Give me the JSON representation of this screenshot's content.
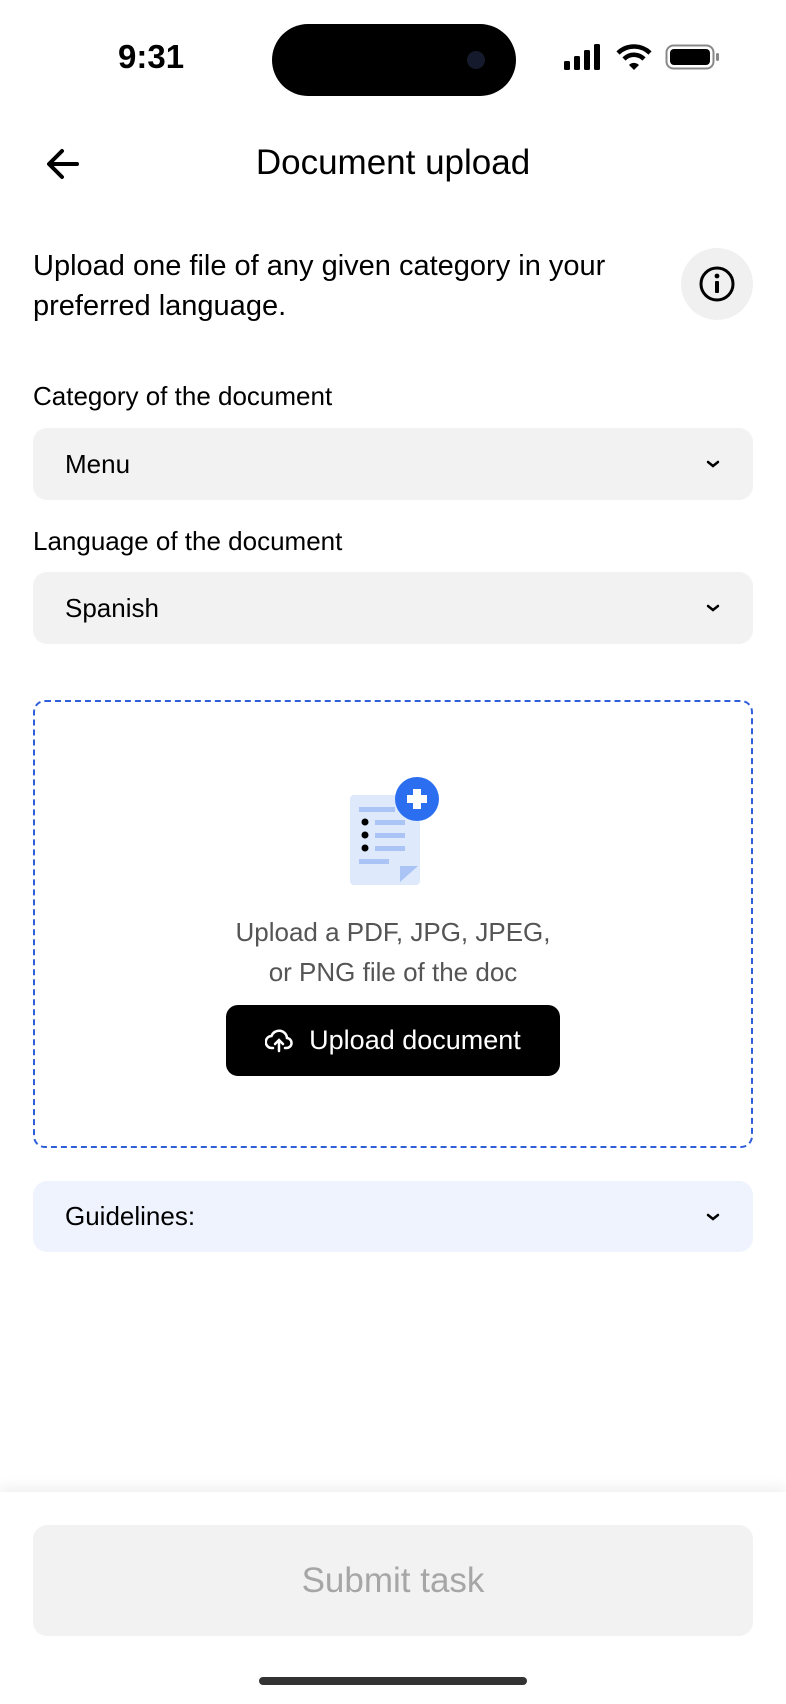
{
  "status_bar": {
    "time": "9:31"
  },
  "header": {
    "title": "Document upload",
    "back_icon": "arrow-left-icon"
  },
  "intro": {
    "text": "Upload one file of any given category in your preferred language.",
    "info_icon": "info-icon"
  },
  "category": {
    "label": "Category of the document",
    "value": "Menu"
  },
  "language": {
    "label": "Language of the document",
    "value": "Spanish"
  },
  "upload": {
    "hint_line1": "Upload a PDF, JPG, JPEG,",
    "hint_line2": "or PNG file of the doc",
    "button_label": "Upload document",
    "accent": "#2b6ef0"
  },
  "guidelines": {
    "label": "Guidelines:"
  },
  "footer": {
    "submit_label": "Submit task"
  }
}
